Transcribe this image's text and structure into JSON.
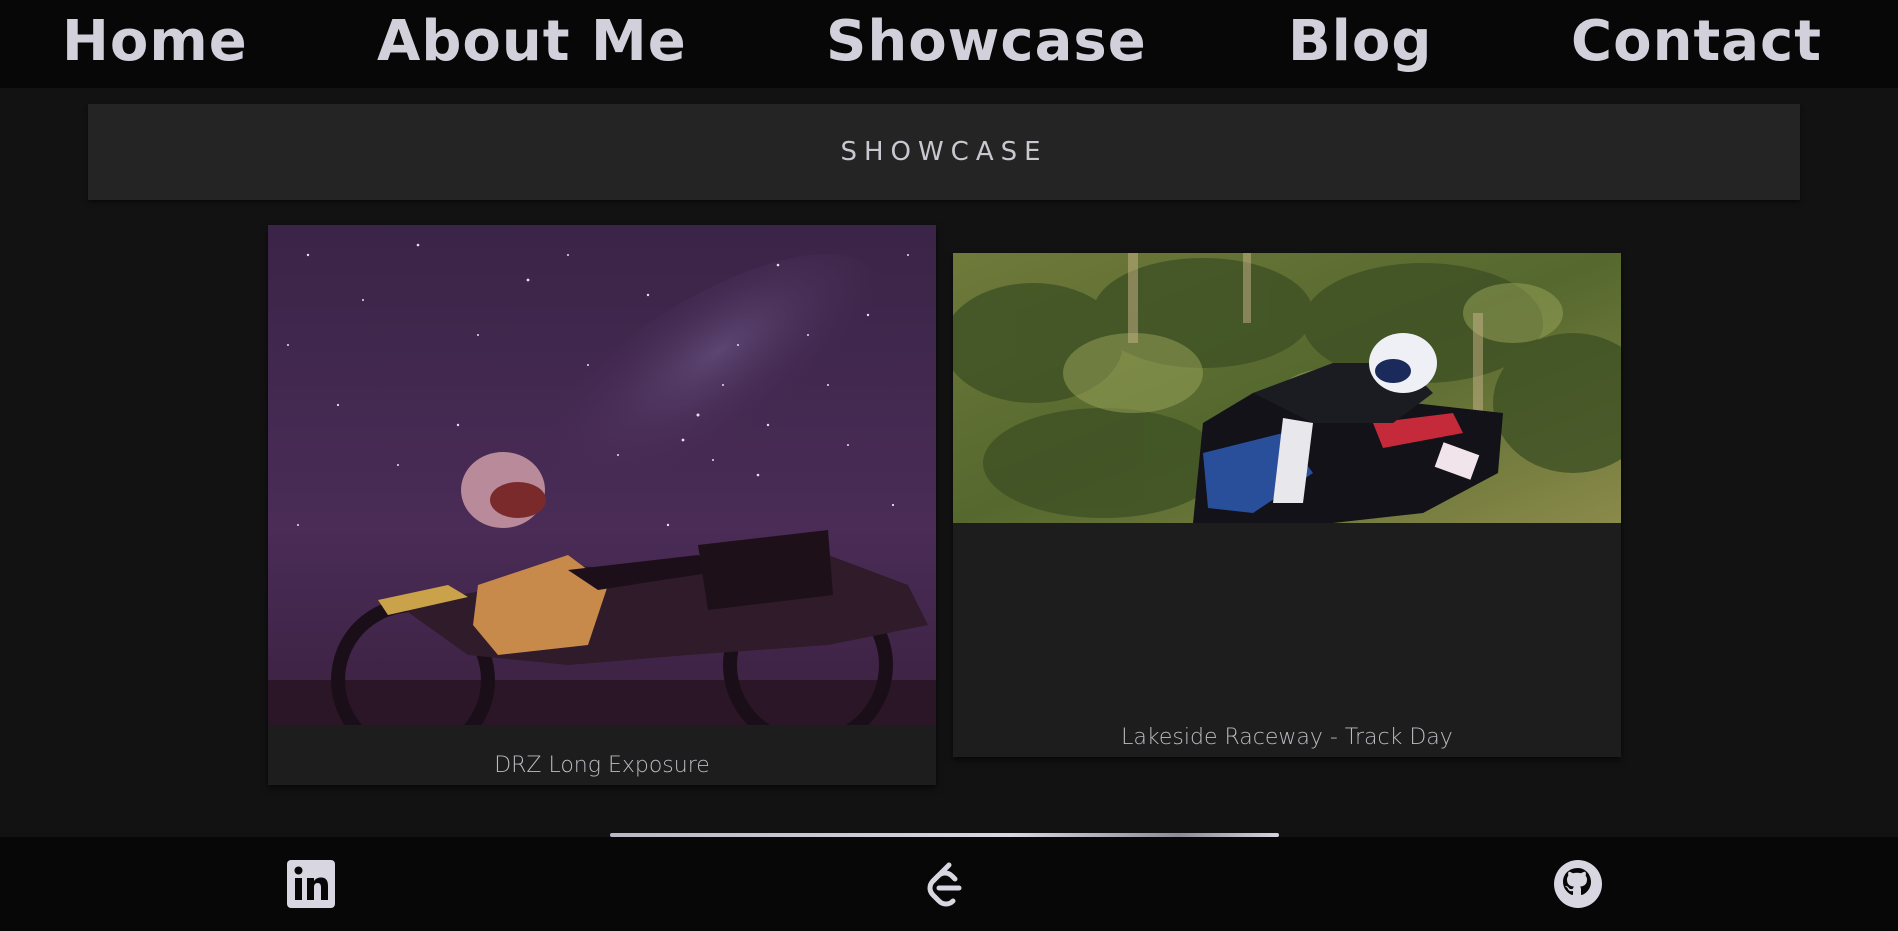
{
  "nav": {
    "items": [
      {
        "label": "Home"
      },
      {
        "label": "About Me"
      },
      {
        "label": "Showcase"
      },
      {
        "label": "Blog"
      },
      {
        "label": "Contact"
      }
    ]
  },
  "section": {
    "title": "SHOWCASE"
  },
  "showcase": {
    "items": [
      {
        "caption": "DRZ Long Exposure",
        "image": "motorcycle-night-sky-photo"
      },
      {
        "caption": "Lakeside Raceway - Track Day",
        "image": "motorcycle-track-racing-photo"
      }
    ]
  },
  "footer": {
    "icons": [
      {
        "icon": "linkedin-icon"
      },
      {
        "icon": "leetcode-icon"
      },
      {
        "icon": "github-icon"
      }
    ]
  },
  "colors": {
    "background": "#121212",
    "nav_background": "#070707",
    "nav_text": "#d2d0da",
    "section_bar": "#242424",
    "card_background": "#1d1d1d",
    "caption_text": "#bcbbc2"
  }
}
